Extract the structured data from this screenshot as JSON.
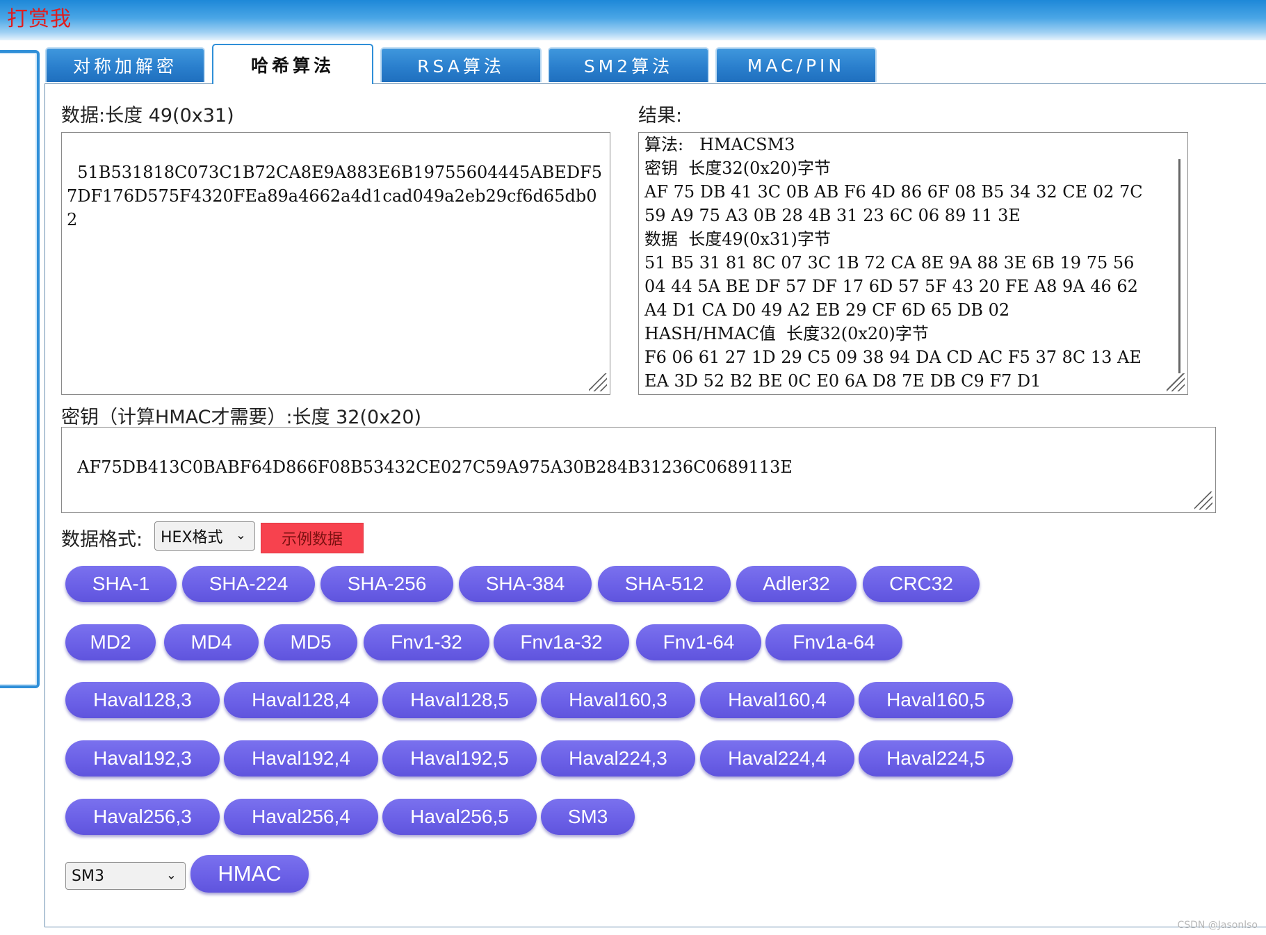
{
  "banner": {
    "title": "打赏我"
  },
  "tabs": [
    {
      "label": "对称加解密",
      "active": false
    },
    {
      "label": "哈希算法",
      "active": true
    },
    {
      "label": "RSA算法",
      "active": false
    },
    {
      "label": "SM2算法",
      "active": false
    },
    {
      "label": "MAC/PIN",
      "active": false
    }
  ],
  "data_section": {
    "label": "数据:长度 49(0x31)",
    "value": "51B531818C073C1B72CA8E9A883E6B19755604445ABEDF57DF176D575F4320FEa89a4662a4d1cad049a2eb29cf6d65db02"
  },
  "result_section": {
    "label": "结果:",
    "lines": [
      "算法:   HMACSM3",
      "密钥  长度32(0x20)字节",
      "AF 75 DB 41 3C 0B AB F6 4D 86 6F 08 B5 34 32 CE 02 7C",
      "59 A9 75 A3 0B 28 4B 31 23 6C 06 89 11 3E",
      "数据  长度49(0x31)字节",
      "51 B5 31 81 8C 07 3C 1B 72 CA 8E 9A 88 3E 6B 19 75 56",
      "04 44 5A BE DF 57 DF 17 6D 57 5F 43 20 FE A8 9A 46 62",
      "A4 D1 CA D0 49 A2 EB 29 CF 6D 65 DB 02",
      "HASH/HMAC值  长度32(0x20)字节",
      "F6 06 61 27 1D 29 C5 09 38 94 DA CD AC F5 37 8C 13 AE",
      "EA 3D 52 B2 BE 0C E0 6A D8 7E DB C9 F7 D1"
    ]
  },
  "key_section": {
    "label": "密钥（计算HMAC才需要）:长度 32(0x20)",
    "value": "AF75DB413C0BABF64D866F08B53432CE027C59A975A30B284B31236C0689113E"
  },
  "format": {
    "label": "数据格式:",
    "selected": "HEX格式",
    "example_button": "示例数据"
  },
  "hash_rows": [
    [
      "SHA-1",
      "SHA-224",
      "SHA-256",
      "SHA-384",
      "SHA-512",
      "Adler32",
      "CRC32"
    ],
    [
      "MD2",
      "MD4",
      "MD5",
      "Fnv1-32",
      "Fnv1a-32",
      "Fnv1-64",
      "Fnv1a-64"
    ],
    [
      "Haval128,3",
      "Haval128,4",
      "Haval128,5",
      "Haval160,3",
      "Haval160,4",
      "Haval160,5"
    ],
    [
      "Haval192,3",
      "Haval192,4",
      "Haval192,5",
      "Haval224,3",
      "Haval224,4",
      "Haval224,5"
    ],
    [
      "Haval256,3",
      "Haval256,4",
      "Haval256,5",
      "SM3"
    ]
  ],
  "hmac": {
    "selected": "SM3",
    "button": "HMAC"
  },
  "watermark": "CSDN @Jasonlso",
  "colors": {
    "button_purple": "#6a5fe6",
    "example_red": "#f7424e",
    "tab_blue": "#2a7fcd",
    "banner_blue": "#1e88d8",
    "title_red": "#e01d1d"
  }
}
